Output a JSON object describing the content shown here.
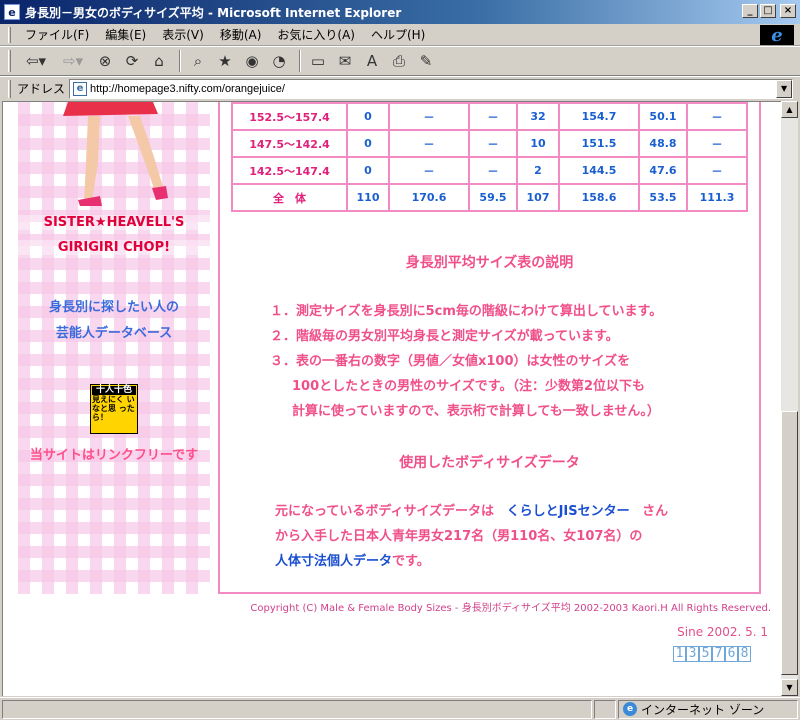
{
  "window": {
    "title": "身長別－男女のボディサイズ平均 - Microsoft Internet Explorer",
    "minimize": "_",
    "maximize": "□",
    "close": "×"
  },
  "menu": [
    "ファイル(F)",
    "編集(E)",
    "表示(V)",
    "移動(A)",
    "お気に入り(A)",
    "ヘルプ(H)"
  ],
  "address": {
    "label": "アドレス",
    "url": "http://homepage3.nifty.com/orangejuice/"
  },
  "sidebar": {
    "title_line1": "SISTER★HEAVELL'S",
    "title_line2": "GIRIGIRI CHOP!",
    "db_line1": "身長別に探したい人の",
    "db_line2": "芸能人データベース",
    "badge_top": "十人十色",
    "badge_body": "見えにく いなと思 ったら！",
    "linkfree": "当サイトはリンクフリーです"
  },
  "table": {
    "rows": [
      [
        "152.5～157.4",
        "0",
        "－",
        "－",
        "32",
        "154.7",
        "50.1",
        "－"
      ],
      [
        "147.5～142.4",
        "0",
        "－",
        "－",
        "10",
        "151.5",
        "48.8",
        "－"
      ],
      [
        "142.5～147.4",
        "0",
        "－",
        "－",
        "2",
        "144.5",
        "47.6",
        "－"
      ],
      [
        "全　体",
        "110",
        "170.6",
        "59.5",
        "107",
        "158.6",
        "53.5",
        "111.3"
      ]
    ]
  },
  "explanation": {
    "heading": "身長別平均サイズ表の説明",
    "item1": "１．測定サイズを身長別に5cm毎の階級にわけて算出しています。",
    "item2": "２．階級毎の男女別平均身長と測定サイズが載っています。",
    "item3_line1": "３．表の一番右の数字（男値／女値x100）は女性のサイズを",
    "item3_line2": "100としたときの男性のサイズです。（注：少数第2位以下も",
    "item3_line3": "計算に使っていますので、表示桁で計算しても一致しません。）"
  },
  "source": {
    "heading": "使用したボディサイズデータ",
    "line1_pre": "元になっているボディサイズデータは",
    "line1_link": "くらしとJISセンター",
    "line1_post": "さん",
    "line2": "から入手した日本人青年男女217名（男110名、女107名）の",
    "line3_link": "人体寸法個人データ",
    "line3_post": "です。"
  },
  "footer": {
    "copyright": "Copyright (C) Male & Female Body Sizes - 身長別ボディサイズ平均 2002-2003 Kaori.H All Rights Reserved.",
    "since": "Sine 2002. 5. 1",
    "counter": [
      "1",
      "3",
      "5",
      "7",
      "6",
      "8"
    ]
  },
  "status": {
    "zone": "インターネット ゾーン"
  }
}
